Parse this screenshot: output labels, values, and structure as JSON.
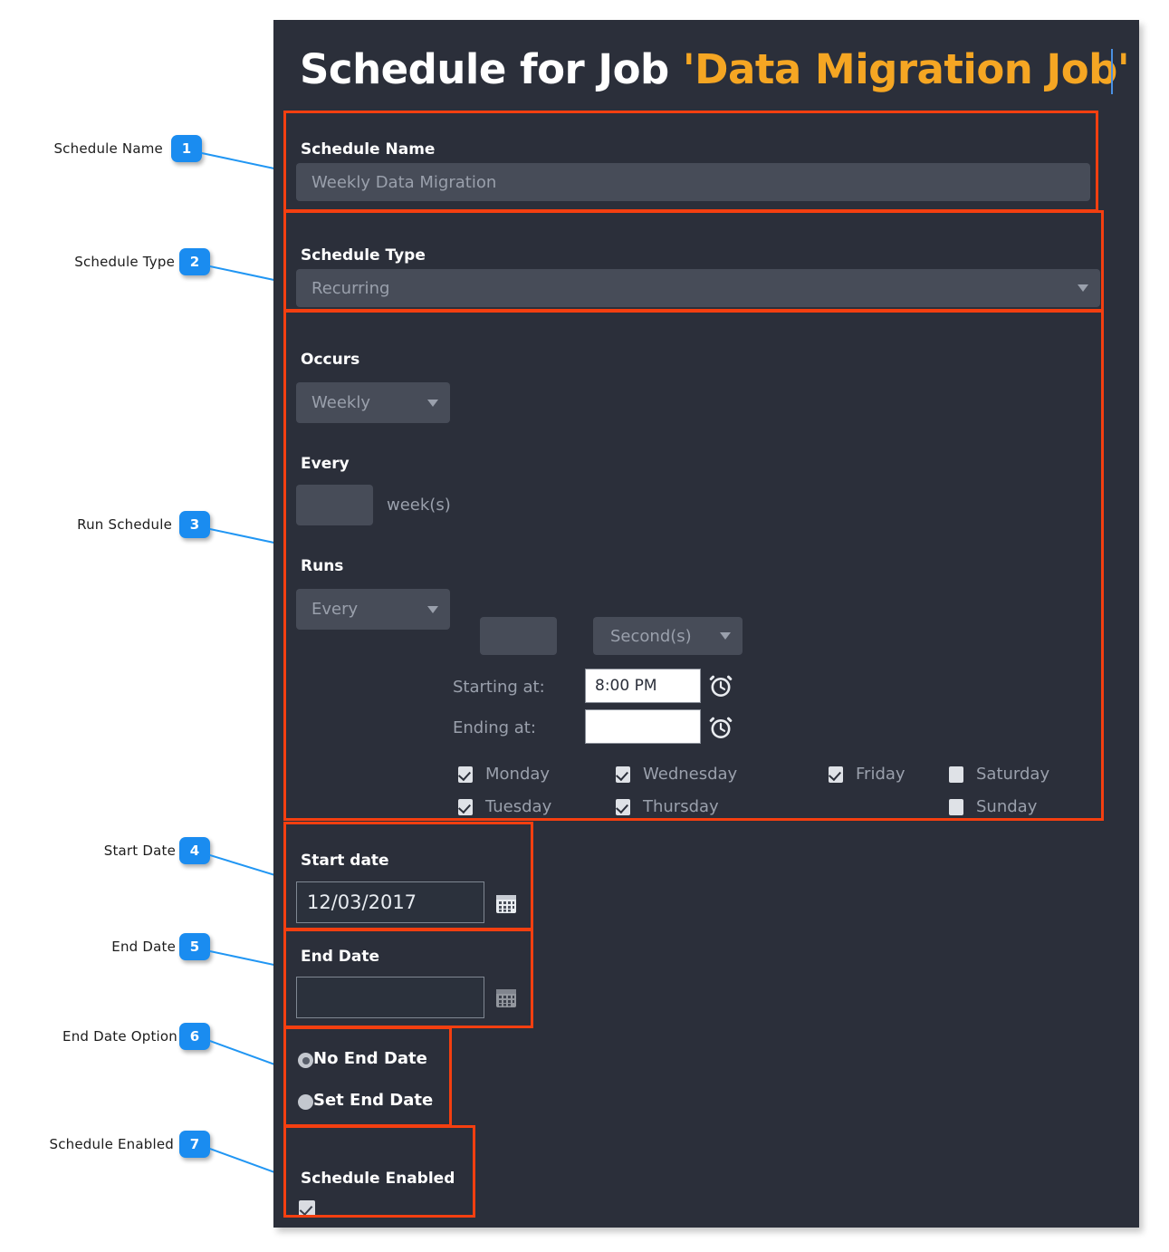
{
  "panel": {
    "title_prefix": "Schedule for Job ",
    "title_job": "'Data Migration Job'",
    "accent_color": "#f5a623",
    "background_color": "#2b2f3a",
    "highlight_color": "#f43f10"
  },
  "fields": {
    "schedule_name": {
      "label": "Schedule Name",
      "value": "Weekly Data Migration"
    },
    "schedule_type": {
      "label": "Schedule Type",
      "value": "Recurring"
    },
    "occurs": {
      "label": "Occurs",
      "value": "Weekly"
    },
    "every": {
      "label": "Every",
      "value": "",
      "unit": "week(s)"
    },
    "runs": {
      "label": "Runs",
      "mode": "Every",
      "interval_value": "",
      "interval_unit": "Second(s)",
      "starting_at_label": "Starting at:",
      "starting_at_value": "8:00 PM",
      "ending_at_label": "Ending at:",
      "ending_at_value": ""
    },
    "start_date": {
      "label": "Start date",
      "value": "12/03/2017"
    },
    "end_date": {
      "label": "End Date",
      "value": ""
    },
    "schedule_enabled": {
      "label": "Schedule Enabled",
      "checked": true
    }
  },
  "weekdays": [
    {
      "name": "Monday",
      "checked": true
    },
    {
      "name": "Tuesday",
      "checked": true
    },
    {
      "name": "Wednesday",
      "checked": true
    },
    {
      "name": "Thursday",
      "checked": true
    },
    {
      "name": "Friday",
      "checked": true
    },
    {
      "name": "Saturday",
      "checked": false
    },
    {
      "name": "Sunday",
      "checked": false
    }
  ],
  "end_date_options": [
    {
      "label": "No End Date",
      "selected": true
    },
    {
      "label": "Set End Date",
      "selected": false
    }
  ],
  "annotations": [
    {
      "number": "1",
      "label": "Schedule Name"
    },
    {
      "number": "2",
      "label": "Schedule Type"
    },
    {
      "number": "3",
      "label": "Run Schedule"
    },
    {
      "number": "4",
      "label": "Start Date"
    },
    {
      "number": "5",
      "label": "End Date"
    },
    {
      "number": "6",
      "label": "End Date Option"
    },
    {
      "number": "7",
      "label": "Schedule Enabled"
    }
  ]
}
